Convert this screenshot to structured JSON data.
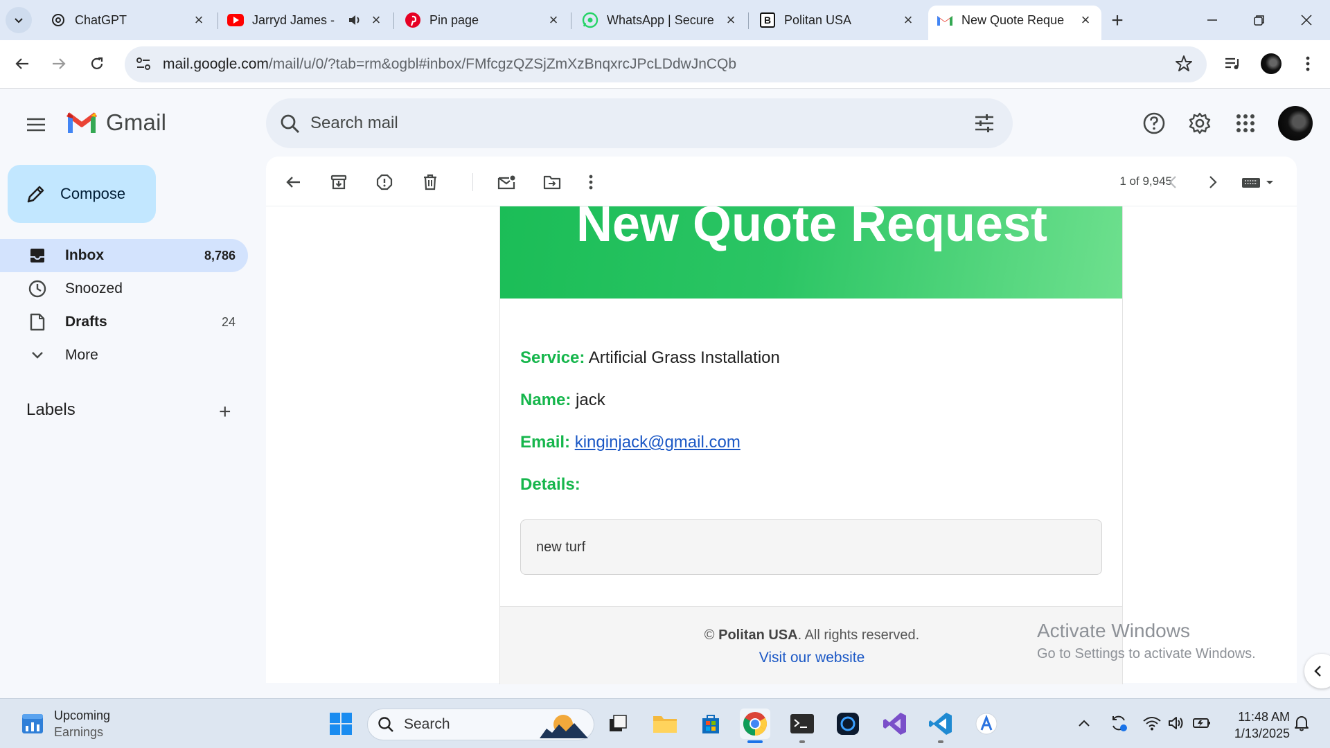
{
  "browser": {
    "tabs": [
      {
        "title": "ChatGPT",
        "icon": "chatgpt-icon"
      },
      {
        "title": "Jarryd James - ",
        "icon": "youtube-icon",
        "audio": true
      },
      {
        "title": "Pin page",
        "icon": "pinterest-icon"
      },
      {
        "title": "WhatsApp | Secure",
        "icon": "whatsapp-icon"
      },
      {
        "title": "Politan USA",
        "icon": "bold-b-icon"
      },
      {
        "title": "New Quote Reque",
        "icon": "gmail-icon",
        "active": true
      }
    ],
    "url_host": "mail.google.com",
    "url_path": "/mail/u/0/?tab=rm&ogbl#inbox/FMfcgzQZSjZmXzBnqxrcJPcLDdwJnCQb"
  },
  "gmail": {
    "product_name": "Gmail",
    "search_placeholder": "Search mail",
    "compose_label": "Compose",
    "nav": [
      {
        "label": "Inbox",
        "count": "8,786",
        "icon": "inbox-icon",
        "active": true
      },
      {
        "label": "Snoozed",
        "count": "",
        "icon": "clock-icon"
      },
      {
        "label": "Drafts",
        "count": "24",
        "icon": "draft-icon"
      },
      {
        "label": "More",
        "count": "",
        "icon": "chevron-down-icon"
      }
    ],
    "labels_heading": "Labels",
    "pager": "1 of 9,945"
  },
  "email": {
    "banner_title": "New Quote Request",
    "fields": {
      "service_key": "Service:",
      "service_value": "Artificial Grass Installation",
      "name_key": "Name:",
      "name_value": "jack",
      "email_key": "Email:",
      "email_value": "kinginjack@gmail.com",
      "details_key": "Details:"
    },
    "details_text": "new turf",
    "footer_copyright": "©",
    "footer_company": "Politan USA",
    "footer_rights": ". All rights reserved.",
    "footer_link": "Visit our website"
  },
  "watermark": {
    "line1": "Activate Windows",
    "line2": "Go to Settings to activate Windows."
  },
  "taskbar": {
    "weather_title": "Upcoming",
    "weather_sub": "Earnings",
    "search_label": "Search",
    "time": "11:48 AM",
    "date": "1/13/2025"
  },
  "colors": {
    "accent_green": "#16b64c",
    "link_blue": "#1a57c5",
    "compose_bg": "#c2e7ff",
    "inbox_active_bg": "#d3e3fd"
  }
}
